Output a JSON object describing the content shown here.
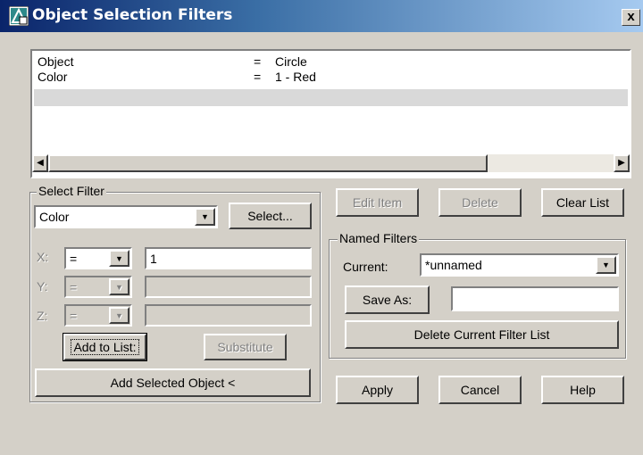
{
  "window": {
    "title": "Object Selection Filters",
    "close_label": "x"
  },
  "filter_list": {
    "rows": [
      {
        "name": "Object",
        "op": "=",
        "value": "Circle"
      },
      {
        "name": "Color",
        "op": "=",
        "value": "1 - Red"
      }
    ]
  },
  "select_filter": {
    "group_label": "Select Filter",
    "type_value": "Color",
    "select_button": "Select...",
    "x_label": "X:",
    "x_op": "=",
    "x_value": "1",
    "y_label": "Y:",
    "y_op": "=",
    "y_value": "",
    "z_label": "Z:",
    "z_op": "=",
    "z_value": "",
    "add_to_list": "Add to List:",
    "substitute": "Substitute",
    "add_selected": "Add Selected Object <"
  },
  "list_actions": {
    "edit_item": "Edit Item",
    "delete": "Delete",
    "clear_list": "Clear List"
  },
  "named_filters": {
    "group_label": "Named Filters",
    "current_label": "Current:",
    "current_value": "*unnamed",
    "save_as": "Save As:",
    "save_as_value": "",
    "delete_current": "Delete Current Filter List"
  },
  "footer": {
    "apply": "Apply",
    "cancel": "Cancel",
    "help": "Help"
  },
  "icons": [
    "filter-app-icon",
    "close-icon",
    "chevron-down-icon",
    "scroll-left-icon",
    "scroll-right-icon"
  ]
}
